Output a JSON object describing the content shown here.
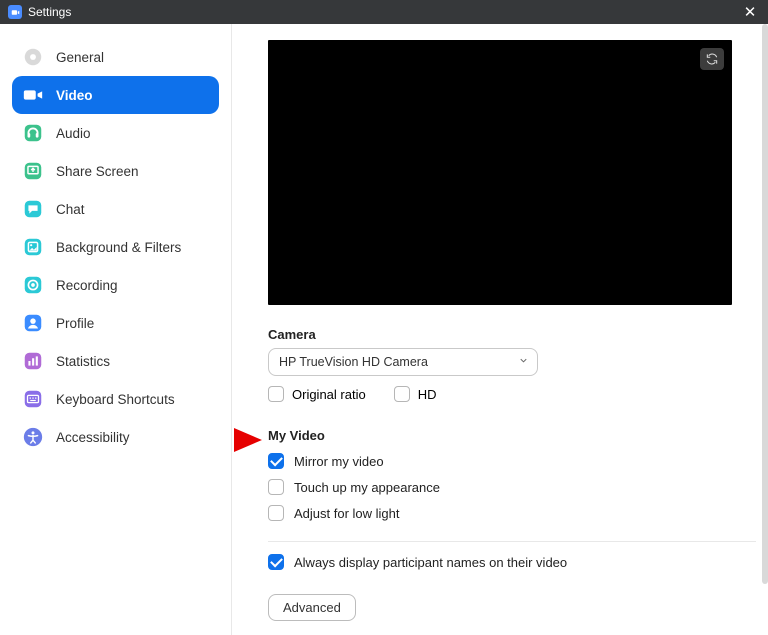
{
  "window": {
    "title": "Settings"
  },
  "sidebar": {
    "items": [
      {
        "label": "General"
      },
      {
        "label": "Video"
      },
      {
        "label": "Audio"
      },
      {
        "label": "Share Screen"
      },
      {
        "label": "Chat"
      },
      {
        "label": "Background & Filters"
      },
      {
        "label": "Recording"
      },
      {
        "label": "Profile"
      },
      {
        "label": "Statistics"
      },
      {
        "label": "Keyboard Shortcuts"
      },
      {
        "label": "Accessibility"
      }
    ]
  },
  "camera": {
    "section_label": "Camera",
    "selected": "HP TrueVision HD Camera",
    "original_ratio_label": "Original ratio",
    "hd_label": "HD",
    "original_ratio_checked": false,
    "hd_checked": false
  },
  "my_video": {
    "section_label": "My Video",
    "mirror_label": "Mirror my video",
    "mirror_checked": true,
    "touchup_label": "Touch up my appearance",
    "touchup_checked": false,
    "lowlight_label": "Adjust for low light",
    "lowlight_checked": false
  },
  "participants": {
    "display_names_label": "Always display participant names on their video",
    "display_names_checked": true
  },
  "advanced_button": "Advanced"
}
